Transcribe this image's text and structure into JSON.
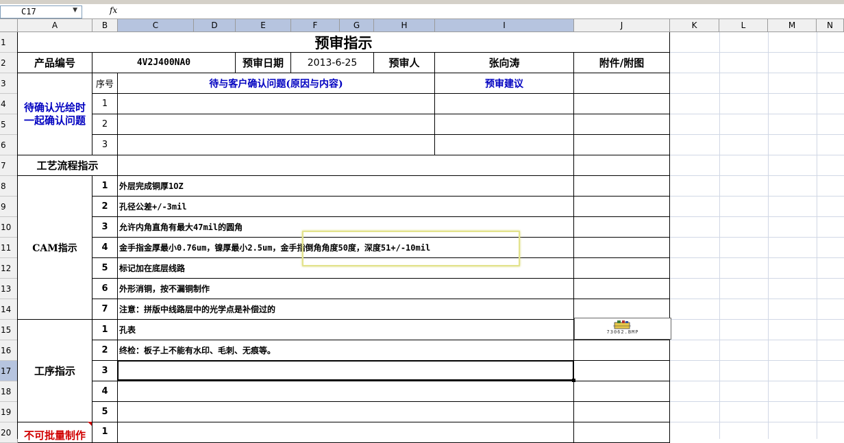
{
  "namebox": "C17",
  "fx_symbol": "fx",
  "columns": [
    "A",
    "B",
    "C",
    "D",
    "E",
    "F",
    "G",
    "H",
    "I",
    "J",
    "K",
    "L",
    "M",
    "N"
  ],
  "rows": [
    "1",
    "2",
    "3",
    "4",
    "5",
    "6",
    "7",
    "8",
    "9",
    "10",
    "11",
    "12",
    "13",
    "14",
    "15",
    "16",
    "17",
    "18",
    "19",
    "20"
  ],
  "sheet": {
    "title": "预审指示",
    "product_label": "产品编号",
    "product_value": "4V2J400NA0",
    "review_date_label": "预审日期",
    "review_date_value": "2013-6-25",
    "reviewer_label": "预审人",
    "reviewer_value": "张向涛",
    "attachment_label": "附件/附图",
    "confirm_section": "待确认光绘时一起确认问题",
    "seq_label": "序号",
    "confirm_header": "待与客户确认问题(原因与内容)",
    "suggest_header": "预审建议",
    "confirm_nums": [
      "1",
      "2",
      "3"
    ],
    "process_flow_label": "工艺流程指示",
    "cam_label": "CAM指示",
    "cam_items": [
      {
        "n": "1",
        "text": "外层完成铜厚1OZ"
      },
      {
        "n": "2",
        "text": "孔径公差+/-3mil"
      },
      {
        "n": "3",
        "text": "允许内角直角有最大47mil的圆角"
      },
      {
        "n": "4",
        "text": "金手指金厚最小0.76um，镍厚最小2.5um，金手指倒角角度50度，深度51+/-10mil"
      },
      {
        "n": "5",
        "text": "标记加在底层线路"
      },
      {
        "n": "6",
        "text": "外形消铜，按不漏铜制作"
      },
      {
        "n": "7",
        "text": "注意：拼版中线路层中的光学点是补偿过的"
      }
    ],
    "proc_label": "工序指示",
    "proc_items": [
      {
        "n": "1",
        "text": "孔表"
      },
      {
        "n": "2",
        "text": "终检：板子上不能有水印、毛刺、无痕等。"
      },
      {
        "n": "3",
        "text": ""
      },
      {
        "n": "4",
        "text": ""
      },
      {
        "n": "5",
        "text": ""
      }
    ],
    "no_batch_label": "不可批量制作",
    "no_batch_num": "1",
    "attachment_file": "73062.BMP"
  }
}
